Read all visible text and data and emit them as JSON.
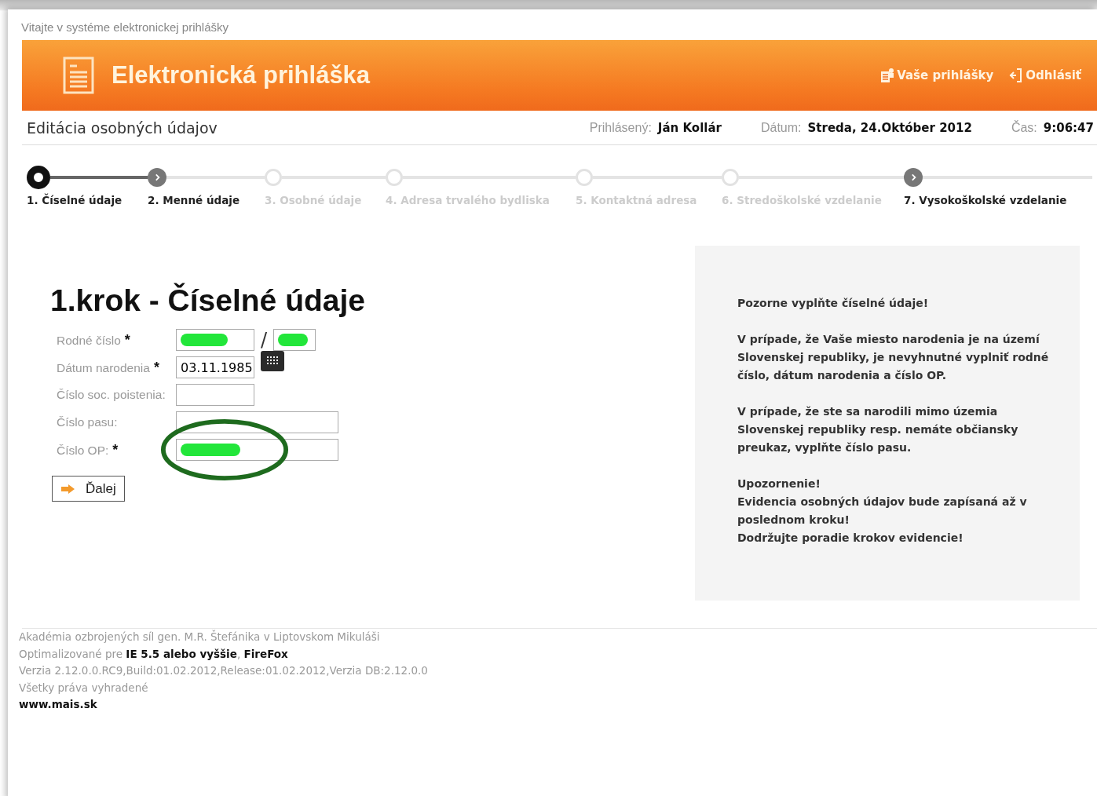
{
  "welcome": "Vitajte v systéme elektronickej prihlášky",
  "banner": {
    "title": "Elektronická prihláška",
    "links": [
      {
        "label": "Vaše prihlášky",
        "kind": "applications"
      },
      {
        "label": "Odhlásiť",
        "kind": "logout"
      }
    ]
  },
  "subheader": {
    "title": "Editácia osobných údajov",
    "info": [
      {
        "label": "Prihlásený:",
        "value": "Ján Kollár"
      },
      {
        "label": "Dátum:",
        "value": "Streda, 24.Október 2012"
      },
      {
        "label": "Čas:",
        "value": "9:06:47"
      }
    ]
  },
  "steps": [
    {
      "label": "1. Číselné údaje",
      "kind": "current"
    },
    {
      "label": "2. Menné údaje",
      "kind": "visited"
    },
    {
      "label": "3. Osobné údaje",
      "kind": "pending"
    },
    {
      "label": "4. Adresa trvalého bydliska",
      "kind": "pending"
    },
    {
      "label": "5. Kontaktná adresa",
      "kind": "pending"
    },
    {
      "label": "6. Stredoškolské vzdelanie",
      "kind": "pending"
    },
    {
      "label": "7. Vysokoškolské vzdelanie",
      "kind": "visited"
    }
  ],
  "form": {
    "heading": "1.krok - Číselné údaje",
    "fields": [
      {
        "label": "Rodné číslo",
        "required": true,
        "kind": "split",
        "redacted": true,
        "highlighted": false
      },
      {
        "label": "Dátum narodenia",
        "required": true,
        "kind": "date",
        "value": "03.11.1985",
        "redacted": false,
        "highlighted": false
      },
      {
        "label": "Číslo soc. poistenia:",
        "required": false,
        "kind": "short",
        "redacted": false,
        "highlighted": false
      },
      {
        "label": "Číslo pasu:",
        "required": false,
        "kind": "long",
        "redacted": false,
        "highlighted": false
      },
      {
        "label": "Číslo OP:",
        "required": true,
        "kind": "long",
        "redacted": true,
        "highlighted": true
      }
    ],
    "required_mark": "*",
    "separator": "/",
    "next_button": "Ďalej"
  },
  "notice": [
    "**Pozorne vyplňte číselné údaje!**",
    "V prípade, že Vaše miesto narodenia je na území Slovenskej republiky, je nevyhnutné vyplniť rodné číslo, dátum narodenia a číslo OP.",
    "V prípade, že ste sa narodili mimo územia Slovenskej republiky resp. nemáte občiansky preukaz, vyplňte číslo pasu.",
    "Upozornenie!\nEvidencia osobných údajov bude zapísaná až v poslednom kroku!\nDodržujte poradie krokov evidencie!"
  ],
  "footer": [
    "Akadémia ozbrojených síl gen. M.R. Štefánika v Liptovskom Mikuláši",
    "Optimalizované pre **IE 5.5 alebo vyššie**, **FireFox**",
    "Verzia 2.12.0.0.RC9,Build:01.02.2012,Release:01.02.2012,Verzia DB:2.12.0.0",
    "Všetky práva vyhradené",
    "**www.mais.sk**"
  ]
}
